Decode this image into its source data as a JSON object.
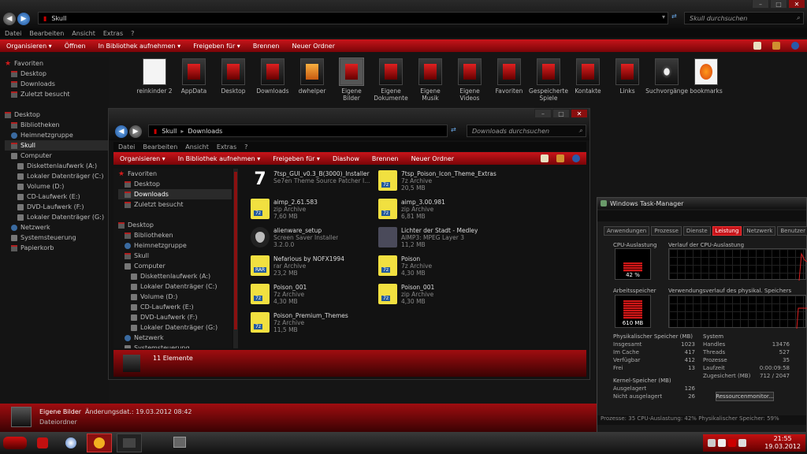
{
  "main": {
    "address": "Skull",
    "search_placeholder": "Skull durchsuchen",
    "menu": [
      "Datei",
      "Bearbeiten",
      "Ansicht",
      "Extras",
      "?"
    ],
    "toolbar": [
      "Organisieren ▾",
      "Öffnen",
      "In Bibliothek aufnehmen ▾",
      "Freigeben für ▾",
      "Brennen",
      "Neuer Ordner"
    ],
    "nav": [
      {
        "label": "Favoriten",
        "icon": "star-icon",
        "indent": 0
      },
      {
        "label": "Desktop",
        "icon": "folder-icon",
        "indent": 1
      },
      {
        "label": "Downloads",
        "icon": "folder-icon",
        "indent": 1
      },
      {
        "label": "Zuletzt besucht",
        "icon": "folder-icon",
        "indent": 1
      },
      {
        "label": "",
        "icon": "",
        "indent": 0
      },
      {
        "label": "Desktop",
        "icon": "folder-icon",
        "indent": 0
      },
      {
        "label": "Bibliotheken",
        "icon": "folder-icon",
        "indent": 1
      },
      {
        "label": "Heimnetzgruppe",
        "icon": "network-icon",
        "indent": 1
      },
      {
        "label": "Skull",
        "icon": "folder-icon",
        "indent": 1,
        "selected": true
      },
      {
        "label": "Computer",
        "icon": "drive-icon",
        "indent": 1
      },
      {
        "label": "Diskettenlaufwerk (A:)",
        "icon": "drive-icon",
        "indent": 2
      },
      {
        "label": "Lokaler Datenträger (C:)",
        "icon": "drive-icon",
        "indent": 2
      },
      {
        "label": "Volume (D:)",
        "icon": "drive-icon",
        "indent": 2
      },
      {
        "label": "CD-Laufwerk (E:)",
        "icon": "drive-icon",
        "indent": 2
      },
      {
        "label": "DVD-Laufwerk (F:)",
        "icon": "drive-icon",
        "indent": 2
      },
      {
        "label": "Lokaler Datenträger (G:)",
        "icon": "drive-icon",
        "indent": 2
      },
      {
        "label": "Netzwerk",
        "icon": "network-icon",
        "indent": 1
      },
      {
        "label": "Systemsteuerung",
        "icon": "drive-icon",
        "indent": 1
      },
      {
        "label": "Papierkorb",
        "icon": "folder-icon",
        "indent": 1
      }
    ],
    "tiles": [
      {
        "label": "reinkinder 2",
        "style": "paper"
      },
      {
        "label": "AppData",
        "style": "plain"
      },
      {
        "label": "Desktop",
        "style": "red"
      },
      {
        "label": "Downloads",
        "style": "red"
      },
      {
        "label": "dwhelper",
        "style": "orange"
      },
      {
        "label": "Eigene Bilder",
        "style": "red",
        "selected": true
      },
      {
        "label": "Eigene Dokumente",
        "style": "red"
      },
      {
        "label": "Eigene Musik",
        "style": "red"
      },
      {
        "label": "Eigene Videos",
        "style": "red"
      },
      {
        "label": "Favoriten",
        "style": "red"
      },
      {
        "label": "Gespeicherte Spiele",
        "style": "red"
      },
      {
        "label": "Kontakte",
        "style": "red"
      },
      {
        "label": "Links",
        "style": "red"
      },
      {
        "label": "Suchvorgänge",
        "style": "search"
      },
      {
        "label": "bookmarks",
        "style": "firefox"
      }
    ],
    "details": {
      "name": "Eigene Bilder",
      "type": "Dateiordner",
      "changed": "Änderungsdat.: 19.03.2012 08:42"
    }
  },
  "downloads": {
    "address": [
      "Skull",
      "Downloads"
    ],
    "search_placeholder": "Downloads durchsuchen",
    "menu": [
      "Datei",
      "Bearbeiten",
      "Ansicht",
      "Extras",
      "?"
    ],
    "toolbar": [
      "Organisieren ▾",
      "In Bibliothek aufnehmen ▾",
      "Freigeben für ▾",
      "Diashow",
      "Brennen",
      "Neuer Ordner"
    ],
    "nav": [
      {
        "label": "Favoriten",
        "icon": "star-icon",
        "indent": 0
      },
      {
        "label": "Desktop",
        "icon": "folder-icon",
        "indent": 1
      },
      {
        "label": "Downloads",
        "icon": "folder-icon",
        "indent": 1,
        "selected": true
      },
      {
        "label": "Zuletzt besucht",
        "icon": "folder-icon",
        "indent": 1
      },
      {
        "label": "",
        "icon": "",
        "indent": 0
      },
      {
        "label": "Desktop",
        "icon": "folder-icon",
        "indent": 0
      },
      {
        "label": "Bibliotheken",
        "icon": "folder-icon",
        "indent": 1
      },
      {
        "label": "Heimnetzgruppe",
        "icon": "network-icon",
        "indent": 1
      },
      {
        "label": "Skull",
        "icon": "folder-icon",
        "indent": 1
      },
      {
        "label": "Computer",
        "icon": "drive-icon",
        "indent": 1
      },
      {
        "label": "Diskettenlaufwerk (A:)",
        "icon": "drive-icon",
        "indent": 2
      },
      {
        "label": "Lokaler Datenträger (C:)",
        "icon": "drive-icon",
        "indent": 2
      },
      {
        "label": "Volume (D:)",
        "icon": "drive-icon",
        "indent": 2
      },
      {
        "label": "CD-Laufwerk (E:)",
        "icon": "drive-icon",
        "indent": 2
      },
      {
        "label": "DVD-Laufwerk (F:)",
        "icon": "drive-icon",
        "indent": 2
      },
      {
        "label": "Lokaler Datenträger (G:)",
        "icon": "drive-icon",
        "indent": 2
      },
      {
        "label": "Netzwerk",
        "icon": "network-icon",
        "indent": 1
      },
      {
        "label": "Systemsteuerung",
        "icon": "drive-icon",
        "indent": 1
      }
    ],
    "files": [
      {
        "name": "7tsp_GUI_v0.3_B(3000)_Installer",
        "line2": "Se7en Theme Source Patcher I...",
        "line3": "",
        "icon": "seven"
      },
      {
        "name": "7tsp_Poison_Icon_Theme_Extras",
        "line2": "7z Archive",
        "line3": "20,5 MB",
        "icon": "7z"
      },
      {
        "name": "aimp_2.61.583",
        "line2": "zip Archive",
        "line3": "7,60 MB",
        "icon": "7z"
      },
      {
        "name": "aimp_3.00.981",
        "line2": "zip Archive",
        "line3": "6,81 MB",
        "icon": "7z"
      },
      {
        "name": "alienware_setup",
        "line2": "Screen Saver Installer",
        "line3": "3.2.0.0",
        "icon": "alien"
      },
      {
        "name": "Lichter der Stadt - Medley",
        "line2": "AIMP3: MPEG Layer 3",
        "line3": "11,2 MB",
        "icon": "mpeg"
      },
      {
        "name": "Nefarious by NOFX1994",
        "line2": "rar Archive",
        "line3": "23,2 MB",
        "icon": "rar"
      },
      {
        "name": "Poison",
        "line2": "7z Archive",
        "line3": "4,30 MB",
        "icon": "7z"
      },
      {
        "name": "Poison_001",
        "line2": "7z Archive",
        "line3": "4,30 MB",
        "icon": "7z"
      },
      {
        "name": "Poison_001",
        "line2": "zip Archive",
        "line3": "4,30 MB",
        "icon": "7z"
      },
      {
        "name": "Poison_Premium_Themes",
        "line2": "7z Archive",
        "line3": "11,5 MB",
        "icon": "7z"
      }
    ],
    "count_label": "11 Elemente"
  },
  "taskmgr": {
    "title": "Windows Task-Manager",
    "tabs": [
      "Anwendungen",
      "Prozesse",
      "Dienste",
      "Leistung",
      "Netzwerk",
      "Benutzer"
    ],
    "active_tab": 3,
    "cpu_label": "CPU-Auslastung",
    "cpu_value": "42 %",
    "cpu_fraction": 0.42,
    "cpu_history_label": "Verlauf der CPU-Auslastung",
    "mem_label": "Arbeitsspeicher",
    "mem_value": "610 MB",
    "mem_history_label": "Verwendungsverlauf des physikal. Speichers",
    "phys_title": "Physikalischer Speicher (MB)",
    "phys": [
      [
        "Insgesamt",
        "1023"
      ],
      [
        "Im Cache",
        "417"
      ],
      [
        "Verfügbar",
        "412"
      ],
      [
        "Frei",
        "13"
      ]
    ],
    "kernel_title": "Kernel-Speicher (MB)",
    "kernel": [
      [
        "Ausgelagert",
        "126"
      ],
      [
        "Nicht ausgelagert",
        "26"
      ]
    ],
    "system_title": "System",
    "system": [
      [
        "Handles",
        "13476"
      ],
      [
        "Threads",
        "527"
      ],
      [
        "Prozesse",
        "35"
      ],
      [
        "Laufzeit",
        "0:00:09:58"
      ],
      [
        "Zugesichert (MB)",
        "712 / 2047"
      ]
    ],
    "monitor_button": "Ressourcenmonitor...",
    "status": "Prozesse: 35    CPU-Auslastung: 42%    Physikalischer Speicher: 59%"
  },
  "taskbar": {
    "time": "21:55",
    "date": "19.03.2012"
  },
  "colors": {
    "accent": "#c8141a",
    "dark": "#111111"
  }
}
